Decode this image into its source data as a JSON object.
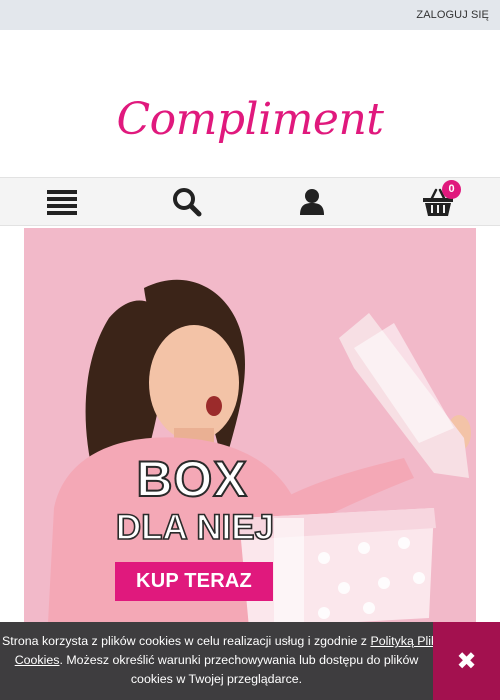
{
  "topbar": {
    "login_label": "ZALOGUJ SIĘ"
  },
  "header": {
    "logo_text": "Compliment"
  },
  "nav": {
    "cart_count": "0"
  },
  "banner": {
    "title_line1": "BOX",
    "title_line2": "DLA NIEJ",
    "cta_label": "KUP TERAZ"
  },
  "cookie": {
    "line1_prefix": "Strona korzysta z plików cookies w celu realizacji usług i zgodnie z ",
    "link_label_part1": "Polityką Plików",
    "link_label_part2": "Cookies",
    "line2_suffix": ". Możesz określić warunki przechowywania lub dostępu do plików",
    "line3": "cookies w Twojej przeglądarce.",
    "close_glyph": "✖"
  },
  "colors": {
    "brand": "#e0197d",
    "cookie_bg": "#3e3d3f",
    "cookie_close_bg": "#a3114f",
    "banner_bg": "#f2b9c9"
  },
  "icons": [
    "menu-icon",
    "search-icon",
    "user-icon",
    "cart-icon",
    "close-icon"
  ]
}
